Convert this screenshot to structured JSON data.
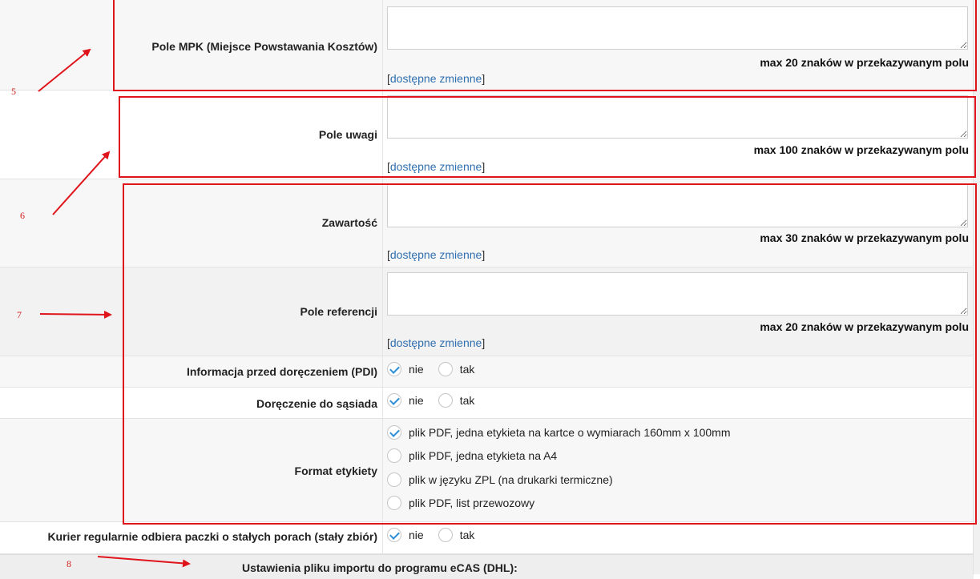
{
  "fields": {
    "mpk": {
      "label": "Pole MPK (Miejsce Powstawania Kosztów)",
      "max": "max 20 znaków w przekazywanym polu",
      "value": ""
    },
    "uwagi": {
      "label": "Pole uwagi",
      "max": "max 100 znaków w przekazywanym polu",
      "value": ""
    },
    "zawartosc": {
      "label": "Zawartość",
      "max": "max 30 znaków w przekazywanym polu",
      "value": ""
    },
    "referencji": {
      "label": "Pole referencji",
      "max": "max 20 znaków w przekazywanym polu",
      "value": ""
    }
  },
  "variables_link": {
    "open": "[",
    "text": "dostępne zmienne",
    "close": "]"
  },
  "pdi": {
    "label": "Informacja przed doręczeniem (PDI)",
    "options": [
      "nie",
      "tak"
    ],
    "selected": "nie"
  },
  "neighbor": {
    "label": "Doręczenie do sąsiada",
    "options": [
      "nie",
      "tak"
    ],
    "selected": "nie"
  },
  "label_format": {
    "label": "Format etykiety",
    "options": [
      "plik PDF, jedna etykieta na kartce o wymiarach 160mm x 100mm",
      "plik PDF, jedna etykieta na A4",
      "plik w języku ZPL (na drukarki termiczne)",
      "plik PDF, list przewozowy"
    ],
    "selected_index": 0
  },
  "regular_pickup": {
    "label": "Kurier regularnie odbiera paczki o stałych porach (stały zbiór)",
    "options": [
      "nie",
      "tak"
    ],
    "selected": "nie"
  },
  "section": {
    "title": "Ustawienia pliku importu do programu eCAS (DHL):"
  },
  "annotations": {
    "numbers": [
      "5",
      "6",
      "7",
      "8"
    ],
    "color": "#e0141b"
  }
}
